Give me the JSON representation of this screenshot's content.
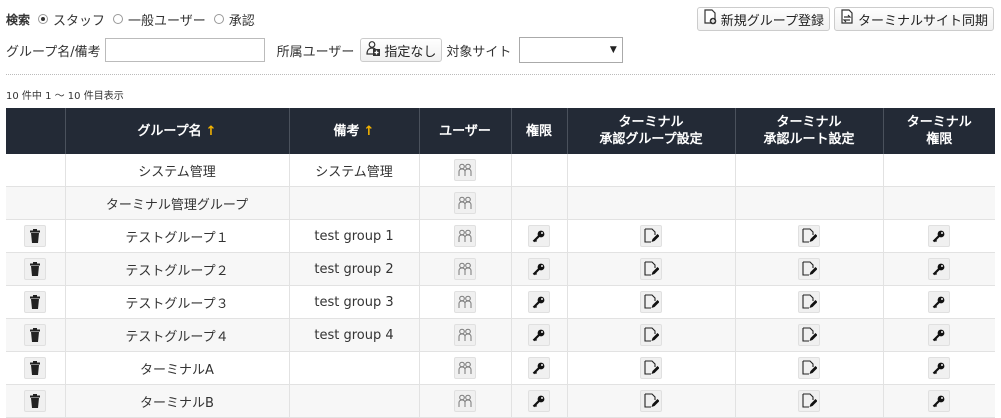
{
  "search": {
    "label": "検索",
    "radios": [
      {
        "label": "スタッフ",
        "checked": true
      },
      {
        "label": "一般ユーザー",
        "checked": false
      },
      {
        "label": "承認",
        "checked": false
      }
    ],
    "group_note_label": "グループ名/備考",
    "group_note_value": "",
    "member_label": "所属ユーザー",
    "member_button": "指定なし",
    "site_label": "対象サイト",
    "site_value": ""
  },
  "toolbar": {
    "new_group": "新規グループ登録",
    "sync": "ターミナルサイト同期"
  },
  "result_count": "10 件中 1 ～ 10 件目表示",
  "table": {
    "headers": {
      "group_name": "グループ名",
      "sort_icon": "↑",
      "note": "備考",
      "user": "ユーザー",
      "permission": "権限",
      "terminal_approval_group_1": "ターミナル",
      "terminal_approval_group_2": "承認グループ設定",
      "terminal_approval_route_1": "ターミナル",
      "terminal_approval_route_2": "承認ルート設定",
      "terminal_permission_1": "ターミナル",
      "terminal_permission_2": "権限"
    },
    "rows": [
      {
        "name": "システム管理",
        "note": "システム管理",
        "deletable": false,
        "editable": false
      },
      {
        "name": "ターミナル管理グループ",
        "note": "",
        "deletable": false,
        "editable": false
      },
      {
        "name": "テストグループ１",
        "note": "test group 1",
        "deletable": true,
        "editable": true
      },
      {
        "name": "テストグループ２",
        "note": "test group 2",
        "deletable": true,
        "editable": true
      },
      {
        "name": "テストグループ３",
        "note": "test group 3",
        "deletable": true,
        "editable": true
      },
      {
        "name": "テストグループ４",
        "note": "test group 4",
        "deletable": true,
        "editable": true
      },
      {
        "name": "ターミナルA",
        "note": "",
        "deletable": true,
        "editable": true
      },
      {
        "name": "ターミナルB",
        "note": "",
        "deletable": true,
        "editable": true
      }
    ]
  },
  "icons": {
    "delete": "trash-icon",
    "users": "users-icon",
    "permission": "key-icon",
    "approval_group": "edit-doc-icon",
    "approval_route": "edit-doc-icon",
    "terminal_permission": "key-icon",
    "new_group": "add-doc-icon",
    "sync": "sync-doc-icon",
    "member": "user-add-icon"
  },
  "colors": {
    "header_bg": "#232a36",
    "sort_arrow": "#f5b400"
  }
}
